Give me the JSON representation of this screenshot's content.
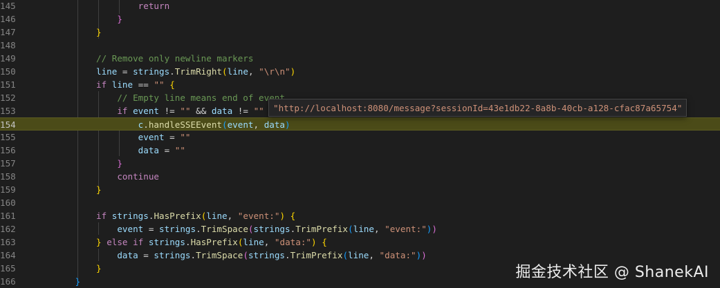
{
  "editor": {
    "lines": [
      {
        "n": "145",
        "indent": 0,
        "tokens": [
          {
            "t": "                    "
          },
          {
            "t": "return",
            "c": "kw"
          }
        ]
      },
      {
        "n": "146",
        "tokens": [
          {
            "t": "                "
          },
          {
            "t": "}",
            "c": "b2"
          }
        ]
      },
      {
        "n": "147",
        "tokens": [
          {
            "t": "            "
          },
          {
            "t": "}",
            "c": "b1"
          }
        ]
      },
      {
        "n": "148",
        "tokens": []
      },
      {
        "n": "149",
        "tokens": [
          {
            "t": "            "
          },
          {
            "t": "// Remove only newline markers",
            "c": "cmt"
          }
        ]
      },
      {
        "n": "150",
        "tokens": [
          {
            "t": "            "
          },
          {
            "t": "line",
            "c": "var"
          },
          {
            "t": " = "
          },
          {
            "t": "strings",
            "c": "var"
          },
          {
            "t": "."
          },
          {
            "t": "TrimRight",
            "c": "fn"
          },
          {
            "t": "(",
            "c": "b1"
          },
          {
            "t": "line",
            "c": "var"
          },
          {
            "t": ", "
          },
          {
            "t": "\"\\r\\n\"",
            "c": "str"
          },
          {
            "t": ")",
            "c": "b1"
          }
        ]
      },
      {
        "n": "151",
        "tokens": [
          {
            "t": "            "
          },
          {
            "t": "if",
            "c": "kw"
          },
          {
            "t": " "
          },
          {
            "t": "line",
            "c": "var"
          },
          {
            "t": " == "
          },
          {
            "t": "\"\"",
            "c": "str"
          },
          {
            "t": " "
          },
          {
            "t": "{",
            "c": "b1"
          }
        ]
      },
      {
        "n": "152",
        "tokens": [
          {
            "t": "                "
          },
          {
            "t": "// Empty line means end of event",
            "c": "cmt"
          }
        ]
      },
      {
        "n": "153",
        "tokens": [
          {
            "t": "                "
          },
          {
            "t": "if",
            "c": "kw"
          },
          {
            "t": " "
          },
          {
            "t": "event",
            "c": "var"
          },
          {
            "t": " != "
          },
          {
            "t": "\"\"",
            "c": "str"
          },
          {
            "t": " && "
          },
          {
            "t": "data",
            "c": "var"
          },
          {
            "t": " != "
          },
          {
            "t": "\"\"",
            "c": "str"
          }
        ]
      },
      {
        "n": "154",
        "current": true,
        "tokens": [
          {
            "t": "                    "
          },
          {
            "t": "c",
            "c": "var"
          },
          {
            "t": "."
          },
          {
            "t": "handleSSEEvent",
            "c": "fn"
          },
          {
            "t": "(",
            "c": "b3"
          },
          {
            "t": "event",
            "c": "var"
          },
          {
            "t": ", "
          },
          {
            "t": "data",
            "c": "var"
          },
          {
            "t": ")",
            "c": "b3"
          }
        ]
      },
      {
        "n": "155",
        "tokens": [
          {
            "t": "                    "
          },
          {
            "t": "event",
            "c": "var"
          },
          {
            "t": " = "
          },
          {
            "t": "\"\"",
            "c": "str"
          }
        ]
      },
      {
        "n": "156",
        "tokens": [
          {
            "t": "                    "
          },
          {
            "t": "data",
            "c": "var"
          },
          {
            "t": " = "
          },
          {
            "t": "\"\"",
            "c": "str"
          }
        ]
      },
      {
        "n": "157",
        "tokens": [
          {
            "t": "                "
          },
          {
            "t": "}",
            "c": "b2"
          }
        ]
      },
      {
        "n": "158",
        "tokens": [
          {
            "t": "                "
          },
          {
            "t": "continue",
            "c": "kw"
          }
        ]
      },
      {
        "n": "159",
        "tokens": [
          {
            "t": "            "
          },
          {
            "t": "}",
            "c": "b1"
          }
        ]
      },
      {
        "n": "160",
        "tokens": []
      },
      {
        "n": "161",
        "tokens": [
          {
            "t": "            "
          },
          {
            "t": "if",
            "c": "kw"
          },
          {
            "t": " "
          },
          {
            "t": "strings",
            "c": "var"
          },
          {
            "t": "."
          },
          {
            "t": "HasPrefix",
            "c": "fn"
          },
          {
            "t": "(",
            "c": "b1"
          },
          {
            "t": "line",
            "c": "var"
          },
          {
            "t": ", "
          },
          {
            "t": "\"event:\"",
            "c": "str"
          },
          {
            "t": ")",
            "c": "b1"
          },
          {
            "t": " "
          },
          {
            "t": "{",
            "c": "b1"
          }
        ]
      },
      {
        "n": "162",
        "tokens": [
          {
            "t": "                "
          },
          {
            "t": "event",
            "c": "var"
          },
          {
            "t": " = "
          },
          {
            "t": "strings",
            "c": "var"
          },
          {
            "t": "."
          },
          {
            "t": "TrimSpace",
            "c": "fn"
          },
          {
            "t": "(",
            "c": "b2"
          },
          {
            "t": "strings",
            "c": "var"
          },
          {
            "t": "."
          },
          {
            "t": "TrimPrefix",
            "c": "fn"
          },
          {
            "t": "(",
            "c": "b3"
          },
          {
            "t": "line",
            "c": "var"
          },
          {
            "t": ", "
          },
          {
            "t": "\"event:\"",
            "c": "str"
          },
          {
            "t": ")",
            "c": "b3"
          },
          {
            "t": ")",
            "c": "b2"
          }
        ]
      },
      {
        "n": "163",
        "tokens": [
          {
            "t": "            "
          },
          {
            "t": "}",
            "c": "b1"
          },
          {
            "t": " "
          },
          {
            "t": "else",
            "c": "kw"
          },
          {
            "t": " "
          },
          {
            "t": "if",
            "c": "kw"
          },
          {
            "t": " "
          },
          {
            "t": "strings",
            "c": "var"
          },
          {
            "t": "."
          },
          {
            "t": "HasPrefix",
            "c": "fn"
          },
          {
            "t": "(",
            "c": "b1"
          },
          {
            "t": "line",
            "c": "var"
          },
          {
            "t": ", "
          },
          {
            "t": "\"data:\"",
            "c": "str"
          },
          {
            "t": ")",
            "c": "b1"
          },
          {
            "t": " "
          },
          {
            "t": "{",
            "c": "b1"
          }
        ]
      },
      {
        "n": "164",
        "tokens": [
          {
            "t": "                "
          },
          {
            "t": "data",
            "c": "var"
          },
          {
            "t": " = "
          },
          {
            "t": "strings",
            "c": "var"
          },
          {
            "t": "."
          },
          {
            "t": "TrimSpace",
            "c": "fn"
          },
          {
            "t": "(",
            "c": "b2"
          },
          {
            "t": "strings",
            "c": "var"
          },
          {
            "t": "."
          },
          {
            "t": "TrimPrefix",
            "c": "fn"
          },
          {
            "t": "(",
            "c": "b3"
          },
          {
            "t": "line",
            "c": "var"
          },
          {
            "t": ", "
          },
          {
            "t": "\"data:\"",
            "c": "str"
          },
          {
            "t": ")",
            "c": "b3"
          },
          {
            "t": ")",
            "c": "b2"
          }
        ]
      },
      {
        "n": "165",
        "tokens": [
          {
            "t": "            "
          },
          {
            "t": "}",
            "c": "b1"
          }
        ]
      },
      {
        "n": "166",
        "tokens": [
          {
            "t": "        "
          },
          {
            "t": "}",
            "c": "b3"
          }
        ]
      }
    ]
  },
  "hover": {
    "text": "\"http://localhost:8080/message?sessionId=43e1db22-8a8b-40cb-a128-cfac87a65754\""
  },
  "watermark": {
    "text": "掘金技术社区 @ ShanekAI"
  },
  "colors": {
    "background": "#1e1e1e",
    "keyword": "#c586c0",
    "string": "#ce9178",
    "comment": "#6a9955",
    "function": "#dcdcaa",
    "variable": "#9cdcfe",
    "current_line": "#4b4b18"
  }
}
